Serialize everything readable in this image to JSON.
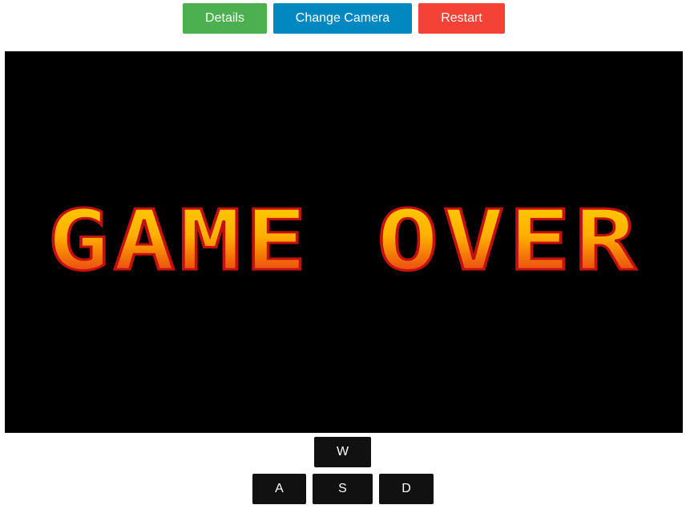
{
  "toolbar": {
    "details_label": "Details",
    "camera_label": "Change Camera",
    "restart_label": "Restart"
  },
  "colors": {
    "details": "#4caf50",
    "camera": "#0288c0",
    "restart": "#f44336",
    "screen_bg": "#000000",
    "text_top": "#ffd400",
    "text_bottom": "#e01818"
  },
  "game": {
    "overlay_text": "GAME OVER"
  },
  "controls": {
    "up": "W",
    "left": "A",
    "down": "S",
    "right": "D"
  }
}
